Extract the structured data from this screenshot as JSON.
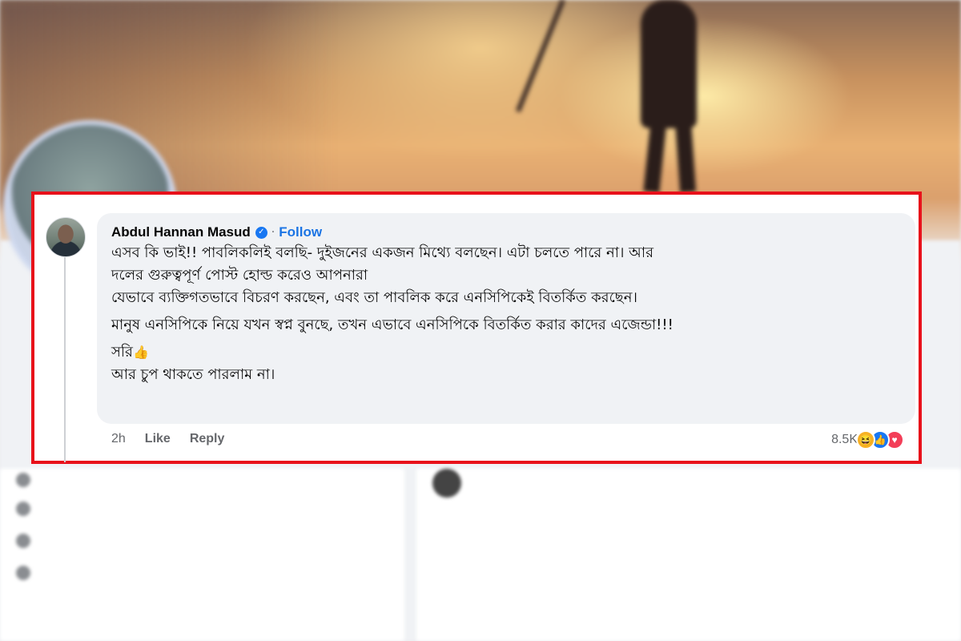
{
  "comment": {
    "author": "Abdul Hannan Masud",
    "separator": "·",
    "follow_label": "Follow",
    "lines": [
      "এসব কি ভাই!! পাবলিকলিই বলছি- দুইজনের একজন মিথ্যে বলছেন। এটা চলতে পারে না। আর",
      "দলের গুরুত্বপূর্ণ পোস্ট হোল্ড করেও আপনারা",
      "যেভাবে ব্যক্তিগতভাবে বিচরণ করছেন, এবং তা পাবলিক করে এনসিপিকেই বিতর্কিত করছেন।"
    ],
    "paragraph2": "মানুষ এনসিপিকে নিয়ে যখন স্বপ্ন বুনছে, তখন এভাবে এনসিপিকে বিতর্কিত করার কাদের এজেন্ডা!!!",
    "sorry": "সরি",
    "last_line": "আর চুপ থাকতে পারলাম না।",
    "time": "2h",
    "like_label": "Like",
    "reply_label": "Reply",
    "reaction_count": "8.5K",
    "reactions": [
      "haha-icon",
      "like-icon",
      "love-icon"
    ]
  },
  "colors": {
    "highlight_border": "#e8101a",
    "bubble_bg": "#f0f2f5",
    "follow_blue": "#1b74e4",
    "meta_gray": "#65676b"
  }
}
